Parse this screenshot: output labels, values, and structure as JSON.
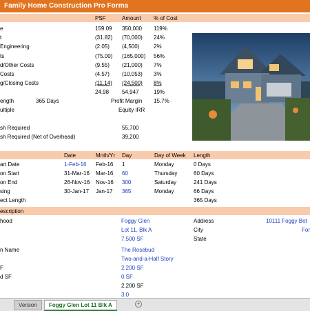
{
  "title": "Family Home Construction Pro Forma",
  "header_cols": {
    "psf": "PSF",
    "amount": "Amount",
    "pct": "% of Cost"
  },
  "cost_rows": [
    {
      "label": "e",
      "psf": "159.09",
      "amount": "350,000",
      "pct": "119%"
    },
    {
      "label": "t",
      "psf": "(31.82)",
      "amount": "(70,000)",
      "pct": "24%"
    },
    {
      "label": "Engineering",
      "psf": "(2.05)",
      "amount": "(4,500)",
      "pct": "2%"
    },
    {
      "label": "ts",
      "psf": "(75.00)",
      "amount": "(165,000)",
      "pct": "56%"
    },
    {
      "label": "d/Other Costs",
      "psf": "(9.55)",
      "amount": "(21,000)",
      "pct": "7%"
    },
    {
      "label": "Costs",
      "psf": "(4.57)",
      "amount": "(10,053)",
      "pct": "3%"
    },
    {
      "label": "g/Closing Costs",
      "psf": "(11.14)",
      "amount": "(24,500)",
      "pct": "8%"
    },
    {
      "label": "",
      "psf": "24.98",
      "amount": "54,947",
      "pct": "19%"
    }
  ],
  "length": {
    "label": "ength",
    "value": "365 Days",
    "margin_label": "Profit Margin",
    "margin_value": "15.7%"
  },
  "multiple": {
    "label": "ultiple",
    "irr_label": "Equity IRR"
  },
  "cash_required": {
    "label": "sh Required",
    "value": "55,700"
  },
  "cash_net": {
    "label": "sh Required (Net of Overhead)",
    "value": "39,200"
  },
  "schedule_header": {
    "date": "Date",
    "mnth": "Mnth/Yr",
    "day": "Day",
    "dow": "Day of Week",
    "length": "Length"
  },
  "schedule_rows": [
    {
      "label": "art Date",
      "date": "1-Feb-16",
      "mnth": "Feb-16",
      "day": "1",
      "dow": "Monday",
      "length": "0 Days"
    },
    {
      "label": "on Start",
      "date": "31-Mar-16",
      "mnth": "Mar-16",
      "day": "60",
      "dow": "Thursday",
      "length": "60 Days"
    },
    {
      "label": "on End",
      "date": "26-Nov-16",
      "mnth": "Nov-16",
      "day": "300",
      "dow": "Saturday",
      "length": "241 Days"
    },
    {
      "label": "sing",
      "date": "30-Jan-17",
      "mnth": "Jan-17",
      "day": "365",
      "dow": "Monday",
      "length": "66 Days"
    },
    {
      "label": "ect Length",
      "date": "",
      "mnth": "",
      "day": "",
      "dow": "",
      "length": "365 Days"
    }
  ],
  "description_header": "escription",
  "description": {
    "neighborhood_label": "hood",
    "neighborhood": "Foggy Glen",
    "lot": "Lot 11, Blk A",
    "lot_size": "7,500 SF",
    "plan_label": "n Name",
    "plan": "The Rosebud",
    "style": "Two-and-a-Half Story",
    "sf1_label": "F",
    "sf1": "2,200 SF",
    "sf2_label": "d SF",
    "sf2": "0 SF",
    "sf3": "2,200 SF",
    "sf4": "3.0",
    "address_label": "Address",
    "address_value": "10111 Foggy Bot",
    "city_label": "City",
    "city_value": "For",
    "state_label": "State"
  },
  "tabs": {
    "tab1": "Version",
    "tab2": "Foggy Glen Lot 11 Blk A",
    "add": "+"
  }
}
